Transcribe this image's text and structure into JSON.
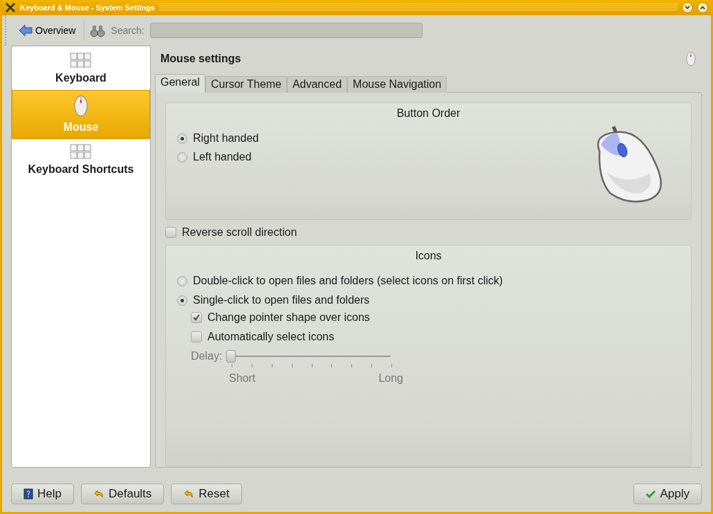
{
  "window": {
    "title": "Keyboard & Mouse - System Settings"
  },
  "toolbar": {
    "overview": "Overview",
    "search_label": "Search:"
  },
  "sidebar": {
    "items": [
      {
        "label": "Keyboard",
        "selected": false
      },
      {
        "label": "Mouse",
        "selected": true
      },
      {
        "label": "Keyboard Shortcuts",
        "selected": false
      }
    ]
  },
  "page": {
    "title": "Mouse settings",
    "tabs": [
      {
        "label": "General",
        "selected": true
      },
      {
        "label": "Cursor Theme",
        "selected": false
      },
      {
        "label": "Advanced",
        "selected": false
      },
      {
        "label": "Mouse Navigation",
        "selected": false
      }
    ],
    "button_order": {
      "title": "Button Order",
      "options": [
        {
          "label": "Right handed",
          "selected": true
        },
        {
          "label": "Left handed",
          "selected": false
        }
      ]
    },
    "reverse_scroll": {
      "label": "Reverse scroll direction",
      "checked": false
    },
    "icons": {
      "title": "Icons",
      "options": [
        {
          "label": "Double-click to open files and folders (select icons on first click)",
          "selected": false
        },
        {
          "label": "Single-click to open files and folders",
          "selected": true
        }
      ],
      "checks": [
        {
          "label": "Change pointer shape over icons",
          "checked": true
        },
        {
          "label": "Automatically select icons",
          "checked": false
        }
      ],
      "delay": {
        "label": "Delay:",
        "level": 0,
        "disabled": true,
        "min_label": "Short",
        "max_label": "Long"
      }
    }
  },
  "buttons": {
    "left": [
      {
        "label": "Help"
      },
      {
        "label": "Defaults"
      },
      {
        "label": "Reset"
      }
    ],
    "right": [
      {
        "label": "Apply"
      }
    ]
  }
}
